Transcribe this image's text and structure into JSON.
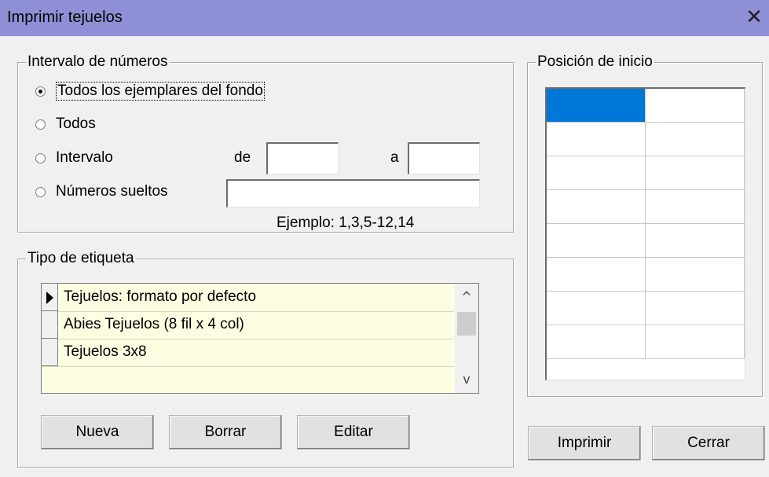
{
  "window": {
    "title": "Imprimir tejuelos",
    "close_glyph": "✕"
  },
  "intervalo": {
    "legend": "Intervalo de números",
    "options": [
      {
        "label": "Todos los ejemplares del fondo",
        "checked": true
      },
      {
        "label": "Todos",
        "checked": false
      },
      {
        "label": "Intervalo",
        "checked": false
      },
      {
        "label": "Números sueltos",
        "checked": false
      }
    ],
    "de_label": "de",
    "a_label": "a",
    "de_value": "",
    "a_value": "",
    "sueltos_value": "",
    "example": "Ejemplo: 1,3,5-12,14"
  },
  "tipo": {
    "legend": "Tipo de etiqueta",
    "rows": [
      {
        "label": "Tejuelos: formato por defecto",
        "current": true
      },
      {
        "label": "Abies Tejuelos (8 fil x 4 col)",
        "current": false
      },
      {
        "label": "Tejuelos 3x8",
        "current": false
      }
    ],
    "scroll_up": "^",
    "scroll_down": "v"
  },
  "buttons": {
    "nueva": "Nueva",
    "borrar": "Borrar",
    "editar": "Editar",
    "imprimir": "Imprimir",
    "cerrar": "Cerrar"
  },
  "posicion": {
    "legend": "Posición de inicio",
    "rows": 8,
    "cols": 2,
    "selected_row": 1,
    "selected_col": 1
  },
  "colors": {
    "titlebar": "#8f8fd6",
    "grid_background": "#fdfde1",
    "selection": "#0078d7"
  }
}
